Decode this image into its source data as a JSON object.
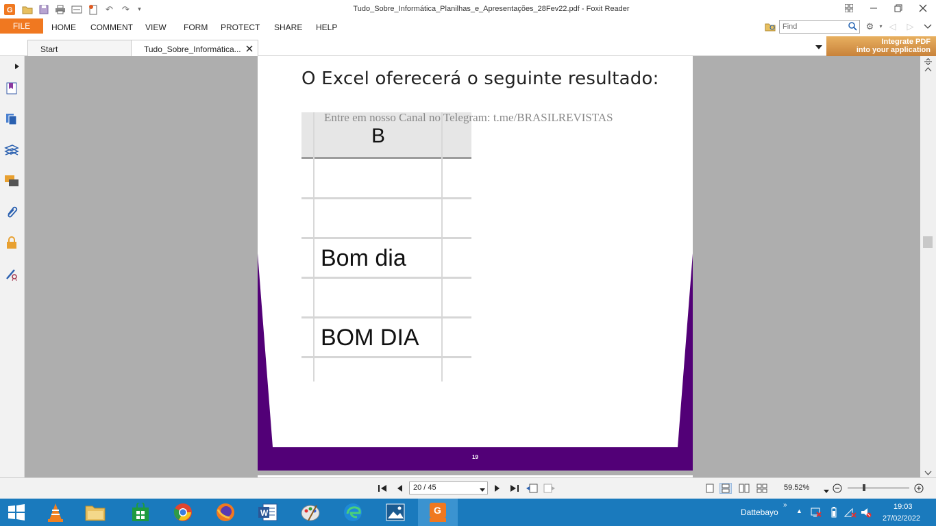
{
  "window": {
    "title": "Tudo_Sobre_Informática_Planilhas_e_Apresentações_28Fev22.pdf - Foxit Reader"
  },
  "menu": {
    "file": "FILE",
    "items": [
      "HOME",
      "COMMENT",
      "VIEW",
      "FORM",
      "PROTECT",
      "SHARE",
      "HELP"
    ],
    "find_placeholder": "Find"
  },
  "tabs": [
    {
      "label": "Start"
    },
    {
      "label": "Tudo_Sobre_Informática..."
    }
  ],
  "promo": {
    "line1": "Integrate PDF",
    "line2": "into your application"
  },
  "page": {
    "heading": "O Excel oferecerá o seguinte resultado:",
    "watermark": "Entre em nosso Canal no Telegram: t.me/BRASILREVISTAS",
    "column_letter": "B",
    "cells": [
      "",
      "",
      "Bom dia",
      "",
      "BOM DIA"
    ],
    "page_number": "19"
  },
  "statusbar": {
    "page_field": "20 / 45",
    "zoom": "59.52%"
  },
  "taskbar": {
    "user": "Dattebayo",
    "time": "19:03",
    "date": "27/02/2022"
  },
  "colors": {
    "file_tab": "#f07820",
    "page_purple": "#520077",
    "taskbar": "#1a7abd"
  }
}
